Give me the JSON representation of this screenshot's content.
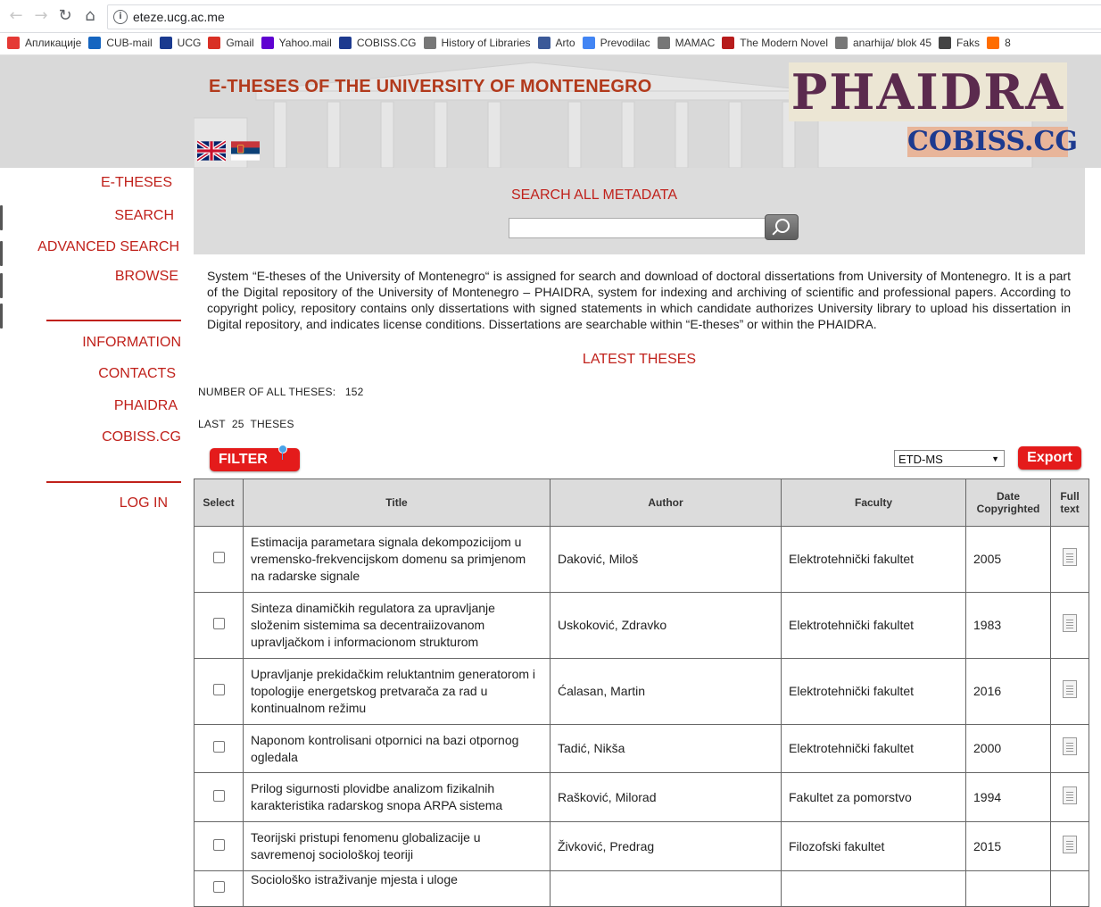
{
  "browser": {
    "url": "eteze.ucg.ac.me",
    "bookmarks": [
      {
        "label": "Апликације",
        "icon": "apps-grid-icon",
        "color": "#e53935"
      },
      {
        "label": "CUB-mail",
        "icon": "cub-mail-icon",
        "color": "#1565c0"
      },
      {
        "label": "UCG",
        "icon": "ucg-icon",
        "color": "#1a3a8f"
      },
      {
        "label": "Gmail",
        "icon": "gmail-icon",
        "color": "#d93025"
      },
      {
        "label": "Yahoo.mail",
        "icon": "yahoo-icon",
        "color": "#5f01d1"
      },
      {
        "label": "COBISS.CG",
        "icon": "cobiss-icon",
        "color": "#1d3a8f"
      },
      {
        "label": "History of Libraries",
        "icon": "page-icon",
        "color": "#777777"
      },
      {
        "label": "Arto",
        "icon": "facebook-icon",
        "color": "#3b5998"
      },
      {
        "label": "Prevodilac",
        "icon": "translate-icon",
        "color": "#4285f4"
      },
      {
        "label": "MAMAC",
        "icon": "page-icon",
        "color": "#777777"
      },
      {
        "label": "The Modern Novel",
        "icon": "m-icon",
        "color": "#b71c1c"
      },
      {
        "label": "anarhija/ blok 45",
        "icon": "page-icon",
        "color": "#777777"
      },
      {
        "label": "Faks",
        "icon": "columns-icon",
        "color": "#444444"
      },
      {
        "label": "8",
        "icon": "play-icon",
        "color": "#ff6d00"
      }
    ]
  },
  "header": {
    "title": "E-THESES OF THE UNIVERSITY OF MONTENEGRO",
    "phaidra_logo": "PHAIDRA",
    "cobiss_logo": "COBISS.CG"
  },
  "sidebar": {
    "items": [
      "E-THESES",
      "SEARCH",
      "ADVANCED SEARCH",
      "BROWSE",
      "INFORMATION",
      "CONTACTS",
      "PHAIDRA",
      "COBISS.CG",
      "LOG IN"
    ]
  },
  "search": {
    "title": "SEARCH ALL METADATA",
    "value": ""
  },
  "intro": "System “E-theses of the University of Montenegro“ is assigned for search and download of doctoral dissertations from University of Montenegro. It is a part of the Digital repository of the University of Montenegro – PHAIDRA, system for indexing and archiving of scientific and professional papers. According to copyright policy, repository contains only dissertations with signed statements in which candidate authorizes University library to upload his dissertation in Digital repository, and indicates license conditions. Dissertations are searchable within “E-theses” or within the PHAIDRA.",
  "latest": {
    "title": "LATEST THESES",
    "count_label": "NUMBER OF ALL THESES:",
    "count": "152",
    "last_label": "LAST",
    "last_n": "25",
    "last_suffix": "THESES"
  },
  "toolbar": {
    "filter_label": "FILTER",
    "format": "ETD-MS",
    "export_label": "Export"
  },
  "table": {
    "headers": {
      "select": "Select",
      "title": "Title",
      "author": "Author",
      "faculty": "Faculty",
      "date": "Date Copyrighted",
      "fulltext": "Full text"
    },
    "rows": [
      {
        "title": "Estimacija parametara signala dekompozicijom u vremensko-frekvencijskom domenu sa primjenom na radarske signale",
        "author": "Daković, Miloš",
        "faculty": "Elektrotehnički fakultet",
        "date": "2005"
      },
      {
        "title": "Sinteza dinamičkih regulatora za upravljanje složenim sistemima sa decentraiizovanom upravljačkom i informacionom strukturom",
        "author": "Uskoković, Zdravko",
        "faculty": "Elektrotehnički fakultet",
        "date": "1983"
      },
      {
        "title": "Upravljanje prekidačkim reluktantnim generatorom i topologije energetskog pretvarača za rad u kontinualnom režimu",
        "author": "Ćalasan, Martin",
        "faculty": "Elektrotehnički fakultet",
        "date": "2016"
      },
      {
        "title": "Naponom kontrolisani otpornici na bazi otpornog ogledala",
        "author": "Tadić, Nikša",
        "faculty": "Elektrotehnički fakultet",
        "date": "2000"
      },
      {
        "title": "Prilog sigurnosti plovidbe analizom fizikalnih karakteristika radarskog snopa ARPA sistema",
        "author": "Rašković, Milorad",
        "faculty": "Fakultet za pomorstvo",
        "date": "1994"
      },
      {
        "title": "Teorijski pristupi fenomenu globalizacije u savremenoj sociološkoj teoriji",
        "author": "Živković, Predrag",
        "faculty": "Filozofski fakultet",
        "date": "2015"
      },
      {
        "title": "Sociološko istraživanje mjesta i uloge",
        "author": "",
        "faculty": "",
        "date": ""
      }
    ]
  }
}
